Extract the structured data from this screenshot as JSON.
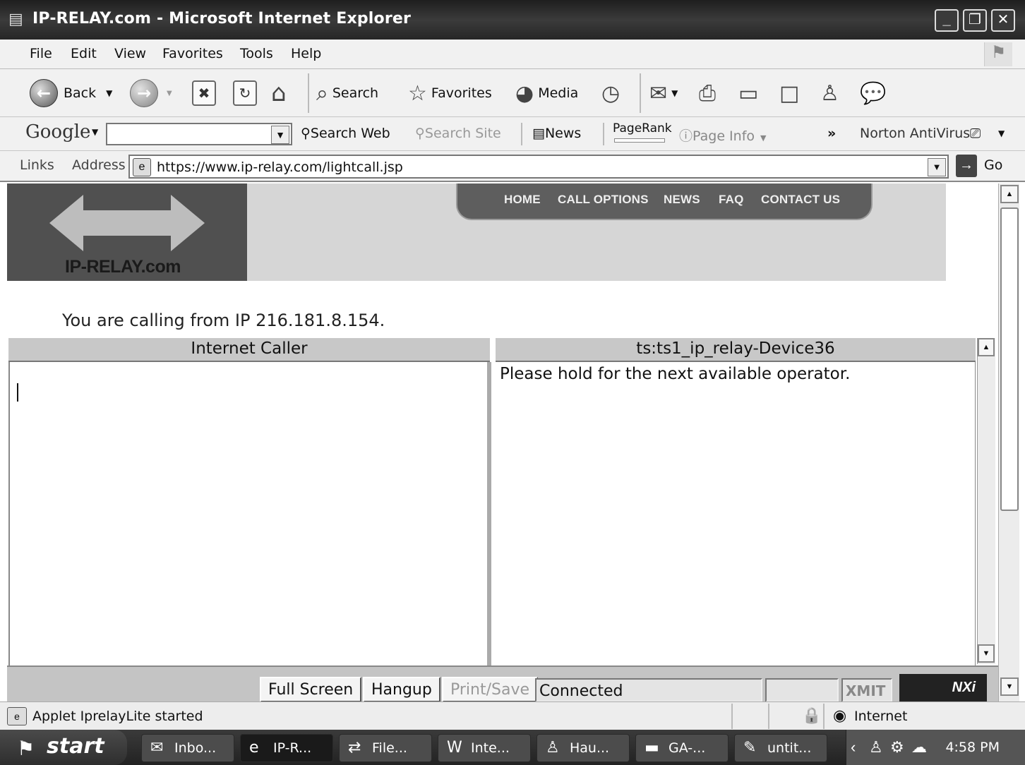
{
  "window": {
    "title": "IP-RELAY.com - Microsoft Internet Explorer",
    "controls": [
      "minimize",
      "restore",
      "close"
    ]
  },
  "menu": [
    "File",
    "Edit",
    "View",
    "Favorites",
    "Tools",
    "Help"
  ],
  "toolbar": {
    "back": "Back",
    "search": "Search",
    "favorites": "Favorites",
    "media": "Media"
  },
  "googlebar": {
    "logo": "Google",
    "search_value": "",
    "search_web": "Search Web",
    "search_site": "Search Site",
    "news": "News",
    "pagerank": "PageRank",
    "page_info": "Page Info",
    "more": "»",
    "norton": "Norton AntiVirus"
  },
  "addressbar": {
    "links": "Links",
    "address": "Address",
    "url": "https://www.ip-relay.com/lightcall.jsp",
    "go": "Go"
  },
  "site": {
    "logo_text": "IP-RELAY.com",
    "nav": [
      "HOME",
      "CALL OPTIONS",
      "NEWS",
      "FAQ",
      "CONTACT US"
    ],
    "calling_text": "You are calling from IP 216.181.8.154."
  },
  "relay": {
    "left_header": "Internet Caller",
    "right_header": "ts:ts1_ip_relay-Device36",
    "right_message": "Please hold for the next available operator.",
    "buttons": {
      "full_screen": "Full Screen",
      "hangup": "Hangup",
      "print_save": "Print/Save"
    },
    "status": "Connected",
    "xmit": "XMIT",
    "brand": "NXi"
  },
  "statusbar": {
    "text": "Applet IprelayLite started",
    "zone": "Internet"
  },
  "taskbar": {
    "start": "start",
    "tasks": [
      "Inbo...",
      "IP-R...",
      "File...",
      "Inte...",
      "Hau...",
      "GA-...",
      "untit..."
    ],
    "active_task": 1,
    "clock": "4:58 PM"
  }
}
